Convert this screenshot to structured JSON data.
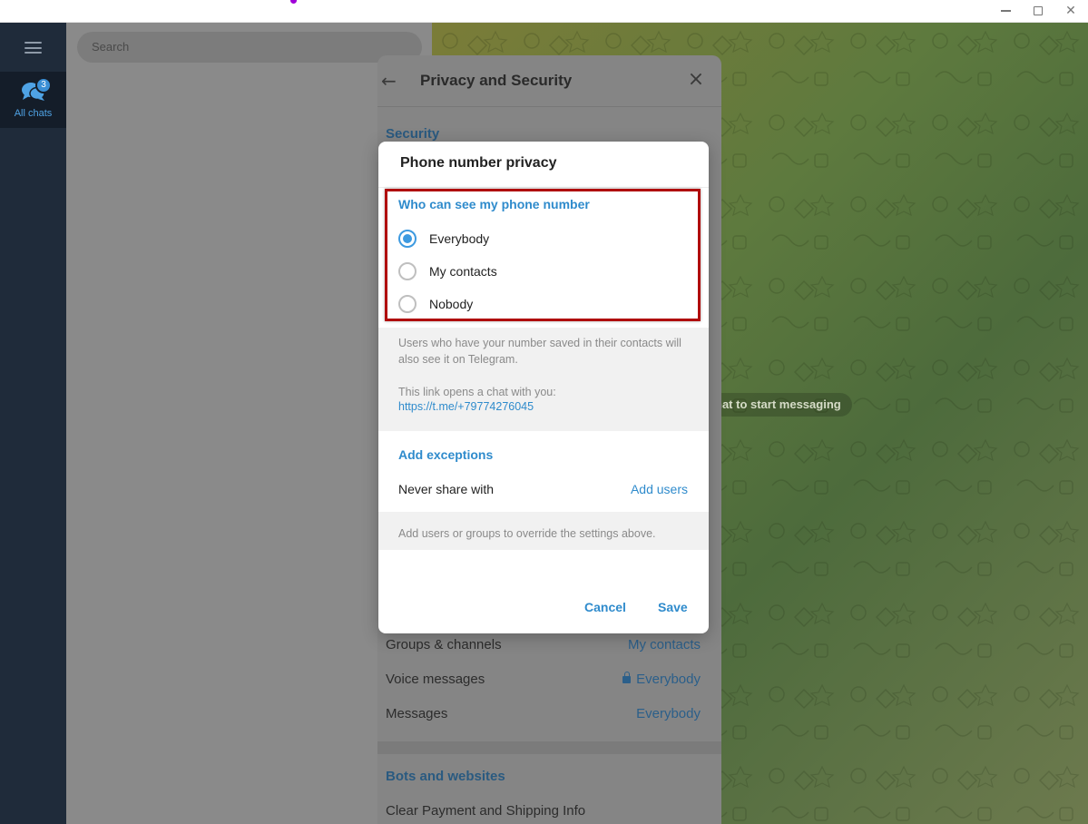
{
  "window": {
    "minimize_icon": "minimize-icon",
    "maximize_icon": "maximize-icon",
    "close_icon": "close-icon"
  },
  "folders": {
    "menu_icon": "menu-icon",
    "active_folder": {
      "label": "All chats",
      "badge": "3",
      "icon": "chats-icon"
    }
  },
  "chatlist": {
    "search_placeholder": "Search"
  },
  "chat_area": {
    "empty_hint": "hat to start messaging"
  },
  "settings_panel": {
    "title": "Privacy and Security",
    "section_security": "Security",
    "rows": [
      {
        "label": "Groups & channels",
        "value": "My contacts",
        "locked": false
      },
      {
        "label": "Voice messages",
        "value": "Everybody",
        "locked": true
      },
      {
        "label": "Messages",
        "value": "Everybody",
        "locked": false
      }
    ],
    "section_bots": "Bots and websites",
    "bots_row": "Clear Payment and Shipping Info"
  },
  "dialog": {
    "title": "Phone number privacy",
    "who_heading": "Who can see my phone number",
    "options": [
      {
        "label": "Everybody",
        "selected": true
      },
      {
        "label": "My contacts",
        "selected": false
      },
      {
        "label": "Nobody",
        "selected": false
      }
    ],
    "info_text": "Users who have your number saved in their contacts will also see it on Telegram.",
    "link_caption": "This link opens a chat with you:",
    "link_url": "https://t.me/+79774276045",
    "exceptions_heading": "Add exceptions",
    "never_share_label": "Never share with",
    "add_users_label": "Add users",
    "exceptions_note": "Add users or groups to override the settings above.",
    "cancel_label": "Cancel",
    "save_label": "Save"
  },
  "colors": {
    "accent": "#2f8bcc",
    "highlight_border": "#b00d0d",
    "sidebar": "#1f2b3a"
  }
}
